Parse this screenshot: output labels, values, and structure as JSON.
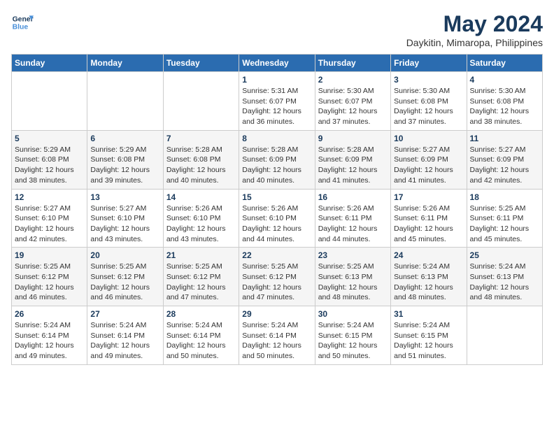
{
  "logo": {
    "line1": "General",
    "line2": "Blue"
  },
  "title": "May 2024",
  "subtitle": "Daykitin, Mimaropa, Philippines",
  "days_of_week": [
    "Sunday",
    "Monday",
    "Tuesday",
    "Wednesday",
    "Thursday",
    "Friday",
    "Saturday"
  ],
  "weeks": [
    [
      {
        "day": "",
        "info": ""
      },
      {
        "day": "",
        "info": ""
      },
      {
        "day": "",
        "info": ""
      },
      {
        "day": "1",
        "info": "Sunrise: 5:31 AM\nSunset: 6:07 PM\nDaylight: 12 hours and 36 minutes."
      },
      {
        "day": "2",
        "info": "Sunrise: 5:30 AM\nSunset: 6:07 PM\nDaylight: 12 hours and 37 minutes."
      },
      {
        "day": "3",
        "info": "Sunrise: 5:30 AM\nSunset: 6:08 PM\nDaylight: 12 hours and 37 minutes."
      },
      {
        "day": "4",
        "info": "Sunrise: 5:30 AM\nSunset: 6:08 PM\nDaylight: 12 hours and 38 minutes."
      }
    ],
    [
      {
        "day": "5",
        "info": "Sunrise: 5:29 AM\nSunset: 6:08 PM\nDaylight: 12 hours and 38 minutes."
      },
      {
        "day": "6",
        "info": "Sunrise: 5:29 AM\nSunset: 6:08 PM\nDaylight: 12 hours and 39 minutes."
      },
      {
        "day": "7",
        "info": "Sunrise: 5:28 AM\nSunset: 6:08 PM\nDaylight: 12 hours and 40 minutes."
      },
      {
        "day": "8",
        "info": "Sunrise: 5:28 AM\nSunset: 6:09 PM\nDaylight: 12 hours and 40 minutes."
      },
      {
        "day": "9",
        "info": "Sunrise: 5:28 AM\nSunset: 6:09 PM\nDaylight: 12 hours and 41 minutes."
      },
      {
        "day": "10",
        "info": "Sunrise: 5:27 AM\nSunset: 6:09 PM\nDaylight: 12 hours and 41 minutes."
      },
      {
        "day": "11",
        "info": "Sunrise: 5:27 AM\nSunset: 6:09 PM\nDaylight: 12 hours and 42 minutes."
      }
    ],
    [
      {
        "day": "12",
        "info": "Sunrise: 5:27 AM\nSunset: 6:10 PM\nDaylight: 12 hours and 42 minutes."
      },
      {
        "day": "13",
        "info": "Sunrise: 5:27 AM\nSunset: 6:10 PM\nDaylight: 12 hours and 43 minutes."
      },
      {
        "day": "14",
        "info": "Sunrise: 5:26 AM\nSunset: 6:10 PM\nDaylight: 12 hours and 43 minutes."
      },
      {
        "day": "15",
        "info": "Sunrise: 5:26 AM\nSunset: 6:10 PM\nDaylight: 12 hours and 44 minutes."
      },
      {
        "day": "16",
        "info": "Sunrise: 5:26 AM\nSunset: 6:11 PM\nDaylight: 12 hours and 44 minutes."
      },
      {
        "day": "17",
        "info": "Sunrise: 5:26 AM\nSunset: 6:11 PM\nDaylight: 12 hours and 45 minutes."
      },
      {
        "day": "18",
        "info": "Sunrise: 5:25 AM\nSunset: 6:11 PM\nDaylight: 12 hours and 45 minutes."
      }
    ],
    [
      {
        "day": "19",
        "info": "Sunrise: 5:25 AM\nSunset: 6:12 PM\nDaylight: 12 hours and 46 minutes."
      },
      {
        "day": "20",
        "info": "Sunrise: 5:25 AM\nSunset: 6:12 PM\nDaylight: 12 hours and 46 minutes."
      },
      {
        "day": "21",
        "info": "Sunrise: 5:25 AM\nSunset: 6:12 PM\nDaylight: 12 hours and 47 minutes."
      },
      {
        "day": "22",
        "info": "Sunrise: 5:25 AM\nSunset: 6:12 PM\nDaylight: 12 hours and 47 minutes."
      },
      {
        "day": "23",
        "info": "Sunrise: 5:25 AM\nSunset: 6:13 PM\nDaylight: 12 hours and 48 minutes."
      },
      {
        "day": "24",
        "info": "Sunrise: 5:24 AM\nSunset: 6:13 PM\nDaylight: 12 hours and 48 minutes."
      },
      {
        "day": "25",
        "info": "Sunrise: 5:24 AM\nSunset: 6:13 PM\nDaylight: 12 hours and 48 minutes."
      }
    ],
    [
      {
        "day": "26",
        "info": "Sunrise: 5:24 AM\nSunset: 6:14 PM\nDaylight: 12 hours and 49 minutes."
      },
      {
        "day": "27",
        "info": "Sunrise: 5:24 AM\nSunset: 6:14 PM\nDaylight: 12 hours and 49 minutes."
      },
      {
        "day": "28",
        "info": "Sunrise: 5:24 AM\nSunset: 6:14 PM\nDaylight: 12 hours and 50 minutes."
      },
      {
        "day": "29",
        "info": "Sunrise: 5:24 AM\nSunset: 6:14 PM\nDaylight: 12 hours and 50 minutes."
      },
      {
        "day": "30",
        "info": "Sunrise: 5:24 AM\nSunset: 6:15 PM\nDaylight: 12 hours and 50 minutes."
      },
      {
        "day": "31",
        "info": "Sunrise: 5:24 AM\nSunset: 6:15 PM\nDaylight: 12 hours and 51 minutes."
      },
      {
        "day": "",
        "info": ""
      }
    ]
  ]
}
